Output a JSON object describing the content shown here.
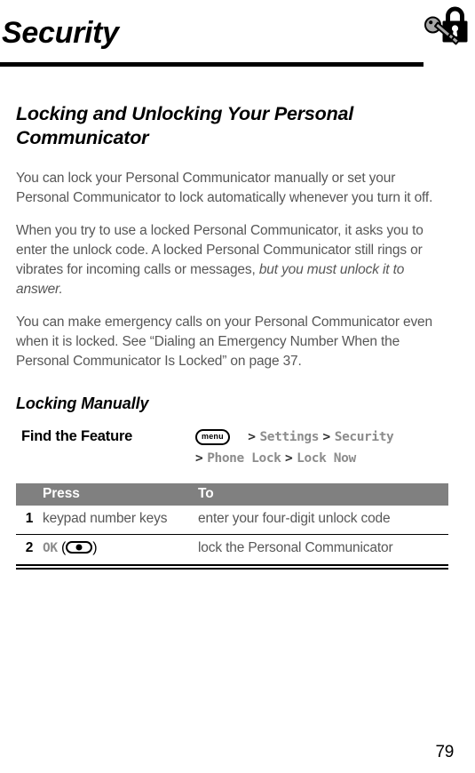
{
  "header": {
    "chapter_title": "Security",
    "icon": "padlock-key-icon"
  },
  "sections": {
    "main_heading": "Locking and Unlocking Your Personal Communicator",
    "paragraph_1": "You can lock your Personal Communicator manually or set your Personal Communicator to lock automatically whenever you turn it off.",
    "paragraph_2_part1": "When you try to use a locked Personal Communicator, it asks you to enter the unlock code. A locked Personal Communicator still rings or vibrates for incoming calls or messages, ",
    "paragraph_2_italic": "but you must unlock it to answer.",
    "paragraph_3": "You can make emergency calls on your Personal Communicator even when it is locked. See “Dialing an Emergency Number When the Personal Communicator Is Locked” on page 37.",
    "sub_heading": "Locking Manually"
  },
  "find_feature": {
    "label": "Find the Feature",
    "menu_key_label": "menu",
    "separator": ">",
    "path_line_1": [
      "Settings",
      "Security"
    ],
    "path_line_2": [
      "Phone Lock",
      "Lock Now"
    ]
  },
  "steps_table": {
    "headers": {
      "number": "",
      "press": "Press",
      "to": "To"
    },
    "rows": [
      {
        "number": "1",
        "press": "keypad number keys",
        "press_key_label": "",
        "to": "enter your four-digit unlock code"
      },
      {
        "number": "2",
        "press": "",
        "press_key_label": "OK",
        "to": "lock the Personal Communicator"
      }
    ]
  },
  "footer": {
    "page_number": "79"
  },
  "colors": {
    "body_text": "#575757",
    "heading": "#000000",
    "table_header_bg": "#808080",
    "mono_gray": "#8c8c8c",
    "rule": "#000000"
  }
}
